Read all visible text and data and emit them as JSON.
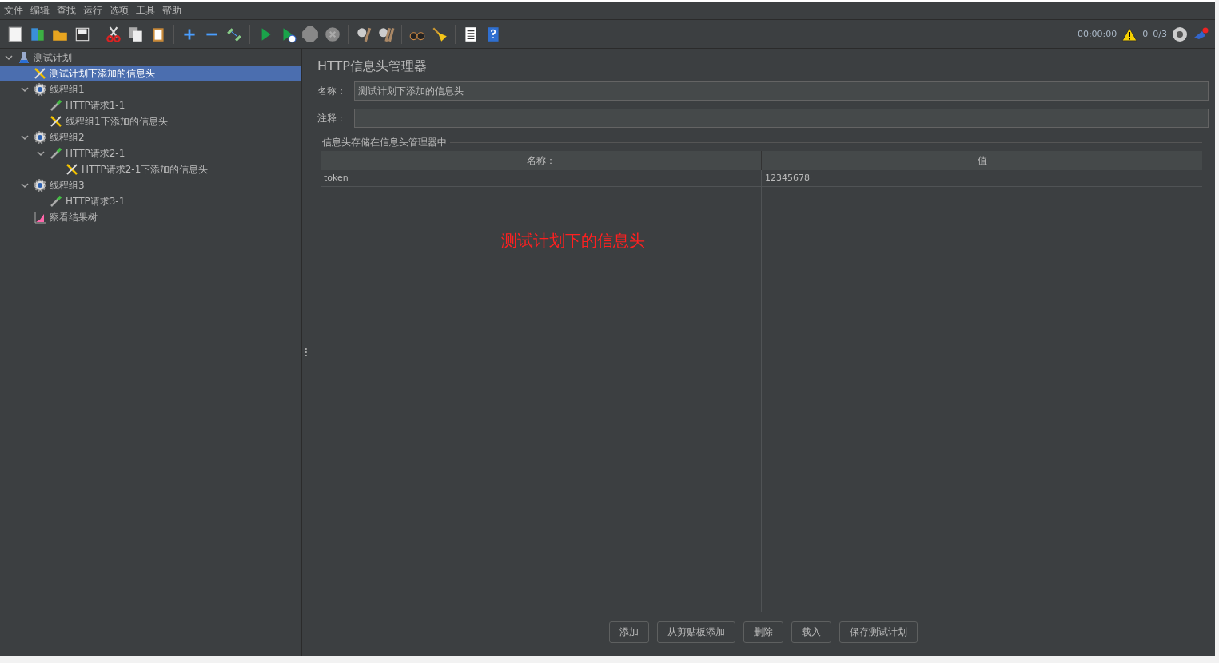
{
  "menu": [
    "文件",
    "编辑",
    "查找",
    "运行",
    "选项",
    "工具",
    "帮助"
  ],
  "status": {
    "timer": "00:00:00",
    "warnings": "0",
    "threads": "0/3"
  },
  "tree": [
    {
      "label": "测试计划",
      "kind": "plan",
      "expanded": true,
      "selected": false,
      "children": [
        {
          "label": "测试计划下添加的信息头",
          "kind": "headers",
          "selected": true
        },
        {
          "label": "线程组1",
          "kind": "group",
          "expanded": true,
          "selected": false,
          "children": [
            {
              "label": "HTTP请求1-1",
              "kind": "sampler",
              "selected": false
            },
            {
              "label": "线程组1下添加的信息头",
              "kind": "headers",
              "selected": false
            }
          ]
        },
        {
          "label": "线程组2",
          "kind": "group",
          "expanded": true,
          "selected": false,
          "children": [
            {
              "label": "HTTP请求2-1",
              "kind": "sampler",
              "expanded": true,
              "selected": false,
              "children": [
                {
                  "label": "HTTP请求2-1下添加的信息头",
                  "kind": "headers",
                  "selected": false
                }
              ]
            }
          ]
        },
        {
          "label": "线程组3",
          "kind": "group",
          "expanded": true,
          "selected": false,
          "children": [
            {
              "label": "HTTP请求3-1",
              "kind": "sampler",
              "selected": false
            }
          ]
        },
        {
          "label": "察看结果树",
          "kind": "listener",
          "selected": false
        }
      ]
    }
  ],
  "panel": {
    "title": "HTTP信息头管理器",
    "name_label": "名称：",
    "name_value": "测试计划下添加的信息头",
    "comment_label": "注释：",
    "group_title": "信息头存储在信息头管理器中",
    "table": {
      "columns": [
        "名称：",
        "值"
      ],
      "rows": [
        [
          "token",
          "12345678"
        ]
      ]
    },
    "annotation": "测试计划下的信息头",
    "buttons": [
      "添加",
      "从剪贴板添加",
      "删除",
      "载入",
      "保存测试计划"
    ]
  }
}
